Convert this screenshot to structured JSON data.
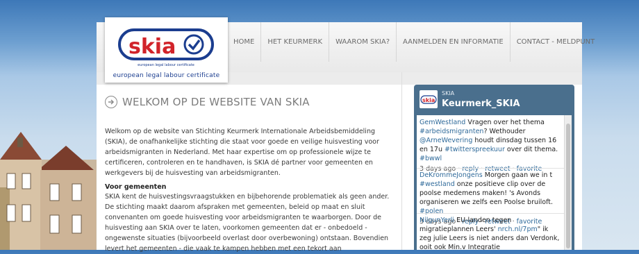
{
  "logo": {
    "wordmark": "skia",
    "tagline_small": "european legal labour certificate",
    "caption": "european legal labour certificate"
  },
  "nav": [
    "HOME",
    "HET KEURMERK",
    "WAAROM SKIA?",
    "AANMELDEN EN INFORMATIE",
    "CONTACT - MELDPUNT"
  ],
  "main": {
    "title": "WELKOM OP DE WEBSITE VAN SKIA",
    "intro": "Welkom op de website van Stichting Keurmerk Internationale Arbeidsbemiddeling (SKIA), de onafhankelijke stichting die staat voor goede en veilige huisvesting voor arbeidsmigranten in Nederland. Met haar expertise om op professionele wijze te certificeren, controleren en te handhaven, is SKIA dé partner voor gemeenten en werkgevers bij de huisvesting van arbeidsmigranten.",
    "gemeenten_heading": "Voor gemeenten",
    "gemeenten_text": "SKIA kent de huisvestingsvraagstukken en bijbehorende problematiek als geen ander. De stichting maakt daarom afspraken met gemeenten, beleid op maat en sluit convenanten om goede huisvesting voor arbeidsmigranten te waarborgen. Door de huisvesting aan SKIA over te laten, voorkomen gemeenten dat er - onbedoeld - ongewenste situaties (bijvoorbeeld overlast door overbewoning) ontstaan. Bovendien levert het gemeenten - die vaak te kampen hebben met een tekort aan"
  },
  "widget": {
    "account_small": "SKIA",
    "account_name": "Keurmerk_SKIA",
    "tweets": [
      {
        "user": "GemWestland",
        "text": "Vragen over het thema",
        "tag1": "#arbeidsmigranten",
        "text2": "? Wethouder",
        "mention": "@ArneWevering",
        "text3": "houdt dinsdag tussen 16 en 17u",
        "tag2": "#twitterspreekuur",
        "text4": "over dit thema.",
        "tag3": "#bwwl",
        "time": "3 days ago",
        "reply": "reply",
        "retweet": "retweet",
        "favorite": "favorite"
      },
      {
        "user": "DeKrommeJongens",
        "text": "Morgen gaan we in t",
        "tag1": "#westland",
        "text2": "onze positieve clip over de poolse medemens maken! 's Avonds organiseren we zelfs een Poolse bruiloft.",
        "tag2": "#polen",
        "time": "3 days ago",
        "reply": "reply",
        "retweet": "retweet",
        "favorite": "favorite"
      },
      {
        "user": "NilgunYerli",
        "text": "EU-landen tegen migratieplannen Leers'",
        "link": "nrch.nl/7pm",
        "text2": "\" ik zeg julie Leers is niet anders dan Verdonk, ooit ook Min.v Integratie"
      }
    ]
  },
  "colors": {
    "brand_red": "#d1232a",
    "brand_blue": "#1b3d8f",
    "widget_bg": "#4a6f8d",
    "link": "#2f6a9a"
  },
  "icons": {
    "title_arrow": "arrow-right-circle-icon",
    "logo_check": "check-circle-icon"
  }
}
